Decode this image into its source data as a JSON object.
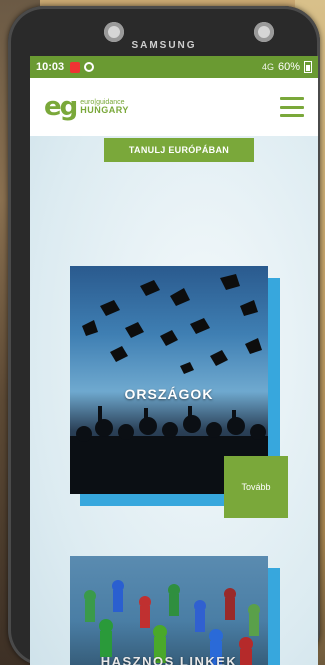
{
  "device": {
    "brand": "SAMSUNG"
  },
  "statusbar": {
    "time": "10:03",
    "signal": "4G",
    "battery": "60%"
  },
  "header": {
    "logo_mark": "eg",
    "logo_top": "euro|guidance",
    "logo_bottom": "HUNGARY"
  },
  "main": {
    "banner_button": "TANULJ EURÓPÁBAN",
    "cards": [
      {
        "title": "ORSZÁGOK",
        "action": "Tovább"
      },
      {
        "title": "HASZNOS LINKEK"
      }
    ]
  },
  "colors": {
    "brand_green": "#7aa83a",
    "accent_blue": "#37a7dd",
    "statusbar_green": "#6a9a32"
  },
  "icons": [
    "notification-icon",
    "sync-icon",
    "battery-icon",
    "hamburger-menu-icon"
  ]
}
